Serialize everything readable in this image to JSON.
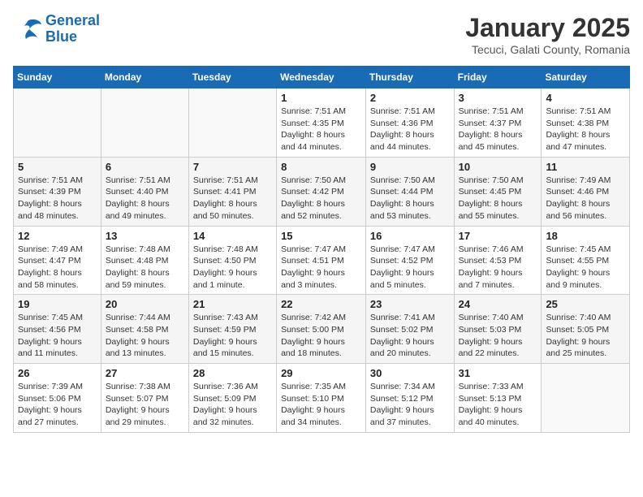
{
  "header": {
    "logo_line1": "General",
    "logo_line2": "Blue",
    "title": "January 2025",
    "subtitle": "Tecuci, Galati County, Romania"
  },
  "columns": [
    "Sunday",
    "Monday",
    "Tuesday",
    "Wednesday",
    "Thursday",
    "Friday",
    "Saturday"
  ],
  "weeks": [
    [
      {
        "day": "",
        "info": ""
      },
      {
        "day": "",
        "info": ""
      },
      {
        "day": "",
        "info": ""
      },
      {
        "day": "1",
        "info": "Sunrise: 7:51 AM\nSunset: 4:35 PM\nDaylight: 8 hours and 44 minutes."
      },
      {
        "day": "2",
        "info": "Sunrise: 7:51 AM\nSunset: 4:36 PM\nDaylight: 8 hours and 44 minutes."
      },
      {
        "day": "3",
        "info": "Sunrise: 7:51 AM\nSunset: 4:37 PM\nDaylight: 8 hours and 45 minutes."
      },
      {
        "day": "4",
        "info": "Sunrise: 7:51 AM\nSunset: 4:38 PM\nDaylight: 8 hours and 47 minutes."
      }
    ],
    [
      {
        "day": "5",
        "info": "Sunrise: 7:51 AM\nSunset: 4:39 PM\nDaylight: 8 hours and 48 minutes."
      },
      {
        "day": "6",
        "info": "Sunrise: 7:51 AM\nSunset: 4:40 PM\nDaylight: 8 hours and 49 minutes."
      },
      {
        "day": "7",
        "info": "Sunrise: 7:51 AM\nSunset: 4:41 PM\nDaylight: 8 hours and 50 minutes."
      },
      {
        "day": "8",
        "info": "Sunrise: 7:50 AM\nSunset: 4:42 PM\nDaylight: 8 hours and 52 minutes."
      },
      {
        "day": "9",
        "info": "Sunrise: 7:50 AM\nSunset: 4:44 PM\nDaylight: 8 hours and 53 minutes."
      },
      {
        "day": "10",
        "info": "Sunrise: 7:50 AM\nSunset: 4:45 PM\nDaylight: 8 hours and 55 minutes."
      },
      {
        "day": "11",
        "info": "Sunrise: 7:49 AM\nSunset: 4:46 PM\nDaylight: 8 hours and 56 minutes."
      }
    ],
    [
      {
        "day": "12",
        "info": "Sunrise: 7:49 AM\nSunset: 4:47 PM\nDaylight: 8 hours and 58 minutes."
      },
      {
        "day": "13",
        "info": "Sunrise: 7:48 AM\nSunset: 4:48 PM\nDaylight: 8 hours and 59 minutes."
      },
      {
        "day": "14",
        "info": "Sunrise: 7:48 AM\nSunset: 4:50 PM\nDaylight: 9 hours and 1 minute."
      },
      {
        "day": "15",
        "info": "Sunrise: 7:47 AM\nSunset: 4:51 PM\nDaylight: 9 hours and 3 minutes."
      },
      {
        "day": "16",
        "info": "Sunrise: 7:47 AM\nSunset: 4:52 PM\nDaylight: 9 hours and 5 minutes."
      },
      {
        "day": "17",
        "info": "Sunrise: 7:46 AM\nSunset: 4:53 PM\nDaylight: 9 hours and 7 minutes."
      },
      {
        "day": "18",
        "info": "Sunrise: 7:45 AM\nSunset: 4:55 PM\nDaylight: 9 hours and 9 minutes."
      }
    ],
    [
      {
        "day": "19",
        "info": "Sunrise: 7:45 AM\nSunset: 4:56 PM\nDaylight: 9 hours and 11 minutes."
      },
      {
        "day": "20",
        "info": "Sunrise: 7:44 AM\nSunset: 4:58 PM\nDaylight: 9 hours and 13 minutes."
      },
      {
        "day": "21",
        "info": "Sunrise: 7:43 AM\nSunset: 4:59 PM\nDaylight: 9 hours and 15 minutes."
      },
      {
        "day": "22",
        "info": "Sunrise: 7:42 AM\nSunset: 5:00 PM\nDaylight: 9 hours and 18 minutes."
      },
      {
        "day": "23",
        "info": "Sunrise: 7:41 AM\nSunset: 5:02 PM\nDaylight: 9 hours and 20 minutes."
      },
      {
        "day": "24",
        "info": "Sunrise: 7:40 AM\nSunset: 5:03 PM\nDaylight: 9 hours and 22 minutes."
      },
      {
        "day": "25",
        "info": "Sunrise: 7:40 AM\nSunset: 5:05 PM\nDaylight: 9 hours and 25 minutes."
      }
    ],
    [
      {
        "day": "26",
        "info": "Sunrise: 7:39 AM\nSunset: 5:06 PM\nDaylight: 9 hours and 27 minutes."
      },
      {
        "day": "27",
        "info": "Sunrise: 7:38 AM\nSunset: 5:07 PM\nDaylight: 9 hours and 29 minutes."
      },
      {
        "day": "28",
        "info": "Sunrise: 7:36 AM\nSunset: 5:09 PM\nDaylight: 9 hours and 32 minutes."
      },
      {
        "day": "29",
        "info": "Sunrise: 7:35 AM\nSunset: 5:10 PM\nDaylight: 9 hours and 34 minutes."
      },
      {
        "day": "30",
        "info": "Sunrise: 7:34 AM\nSunset: 5:12 PM\nDaylight: 9 hours and 37 minutes."
      },
      {
        "day": "31",
        "info": "Sunrise: 7:33 AM\nSunset: 5:13 PM\nDaylight: 9 hours and 40 minutes."
      },
      {
        "day": "",
        "info": ""
      }
    ]
  ]
}
